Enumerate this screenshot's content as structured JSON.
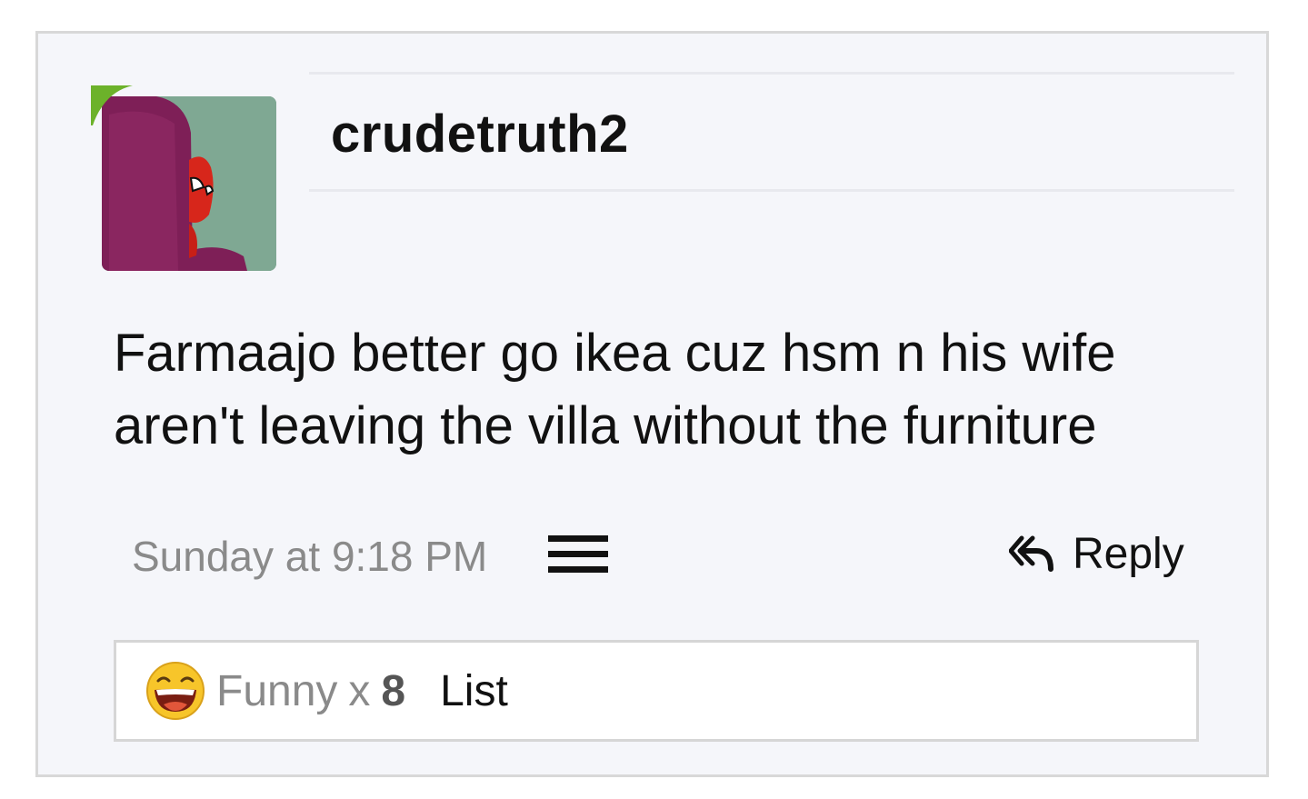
{
  "post": {
    "username": "crudetruth2",
    "message_line1": "Farmaajo better go ikea cuz hsm n his wife",
    "message_line2": "aren't leaving the villa without the furniture",
    "timestamp": "Sunday at 9:18 PM",
    "reply_label": "Reply",
    "avatar_icon": "spiderman-avatar",
    "online_badge_color": "#6cb22a"
  },
  "reactions": {
    "icon": "laughing-emoji-icon",
    "label": "Funny",
    "multiplier": "x",
    "count": "8",
    "list_label": "List"
  }
}
